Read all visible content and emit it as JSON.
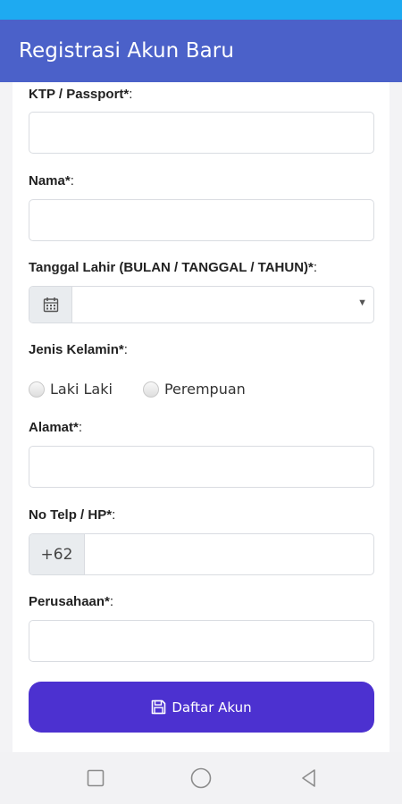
{
  "app_bar": {
    "title": "Registrasi Akun Baru"
  },
  "form": {
    "ktp": {
      "label": "KTP / Passport*",
      "colon": ":",
      "value": ""
    },
    "nama": {
      "label": "Nama*",
      "colon": ":",
      "value": ""
    },
    "tanggal_lahir": {
      "label": "Tanggal Lahir (BULAN / TANGGAL / TAHUN)*",
      "colon": ":",
      "value": ""
    },
    "jenis_kelamin": {
      "label": "Jenis Kelamin*",
      "colon": ":",
      "options": [
        "Laki Laki",
        "Perempuan"
      ]
    },
    "alamat": {
      "label": "Alamat*",
      "colon": ":",
      "value": ""
    },
    "telp": {
      "label": "No Telp / HP*",
      "colon": ":",
      "prefix": "+62",
      "value": ""
    },
    "perusahaan": {
      "label": "Perusahaan*",
      "colon": ":",
      "value": ""
    },
    "submit_label": "Daftar Akun"
  },
  "icons": {
    "date": "calendar-icon",
    "submit": "save-icon",
    "nav": [
      "square-recent-icon",
      "circle-home-icon",
      "triangle-back-icon"
    ]
  },
  "colors": {
    "status_bar": "#1eaaf1",
    "app_bar": "#4b61c9",
    "submit": "#4c31d0"
  }
}
